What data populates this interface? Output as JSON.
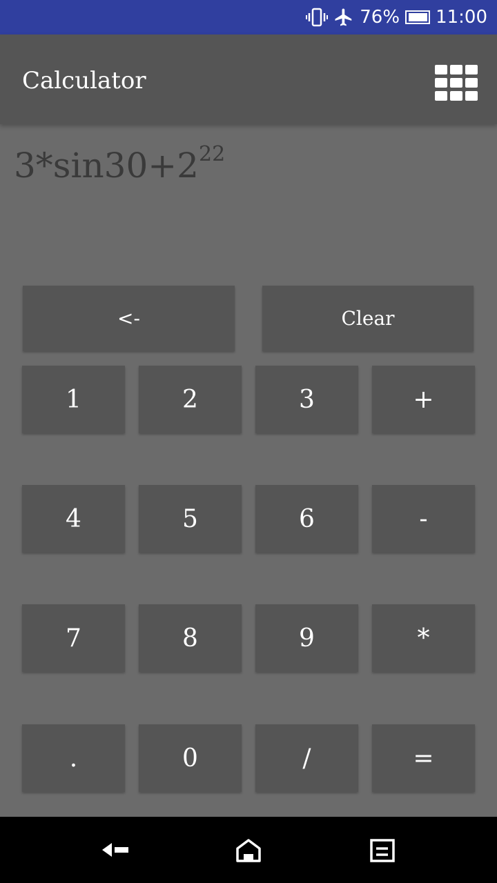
{
  "status_bar": {
    "battery_percent": "76%",
    "time": "11:00",
    "icons": [
      "vibrate-icon",
      "airplane-mode-icon",
      "battery-icon"
    ]
  },
  "app_bar": {
    "title": "Calculator",
    "menu_icon": "grid-icon"
  },
  "display": {
    "expression_main": "3*sin30+2",
    "expression_exponent": "22"
  },
  "keypad": {
    "backspace_label": "<-",
    "clear_label": "Clear",
    "keys": [
      "1",
      "2",
      "3",
      "+",
      "4",
      "5",
      "6",
      "-",
      "7",
      "8",
      "9",
      "*",
      ".",
      "0",
      "/",
      "="
    ]
  },
  "nav_bar": {
    "icons": [
      "back-icon",
      "home-icon",
      "recents-icon"
    ]
  },
  "colors": {
    "status_bar": "#303f9f",
    "app_bar": "#555555",
    "background": "#6b6b6b",
    "button": "#555555",
    "expression_text": "#3a3a3a"
  }
}
